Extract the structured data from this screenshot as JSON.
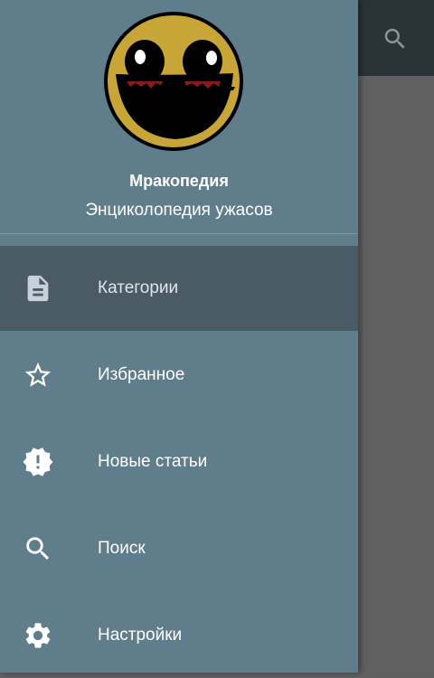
{
  "app": {
    "title": "Мракопедия",
    "subtitle": "Энциколопедия ужасов"
  },
  "colors": {
    "drawer": "#607d8b",
    "active_item": "#4a5b66",
    "appbar": "#2a3338",
    "avatar_face": "#c7a536"
  },
  "appbar": {
    "search_icon": "search-icon"
  },
  "menu": {
    "items": [
      {
        "label": "Категории",
        "icon": "document-icon",
        "active": true
      },
      {
        "label": "Избранное",
        "icon": "star-outline-icon",
        "active": false
      },
      {
        "label": "Новые статьи",
        "icon": "new-badge-icon",
        "active": false
      },
      {
        "label": "Поиск",
        "icon": "search-icon",
        "active": false
      },
      {
        "label": "Настройки",
        "icon": "gear-icon",
        "active": false
      }
    ]
  }
}
